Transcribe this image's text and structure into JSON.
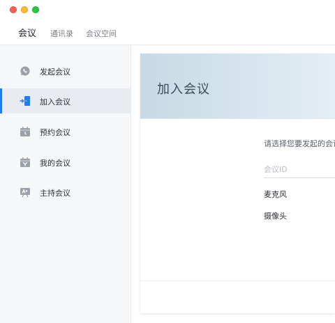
{
  "window": {
    "traffic_lights": [
      "close",
      "minimize",
      "maximize"
    ]
  },
  "top_tabs": [
    {
      "label": "会议",
      "active": true
    },
    {
      "label": "通讯录",
      "active": false
    },
    {
      "label": "会议空间",
      "active": false
    }
  ],
  "sidebar": {
    "items": [
      {
        "label": "发起会议",
        "icon": "phone-bubble-icon",
        "active": false
      },
      {
        "label": "加入会议",
        "icon": "enter-door-icon",
        "active": true
      },
      {
        "label": "预约会议",
        "icon": "calendar-clock-icon",
        "active": false
      },
      {
        "label": "我的会议",
        "icon": "calendar-user-icon",
        "active": false
      },
      {
        "label": "主持会议",
        "icon": "presenter-icon",
        "active": false
      }
    ]
  },
  "panel": {
    "title": "加入会议",
    "hint": "请选择您要发起的会议",
    "meeting_id_placeholder": "会议ID",
    "microphone_label": "麦克风",
    "camera_label": "摄像头"
  },
  "colors": {
    "accent": "#1f7cf2",
    "sidebar_bg": "#f6f7f9",
    "header_gradient_start": "#c7d9e5"
  }
}
